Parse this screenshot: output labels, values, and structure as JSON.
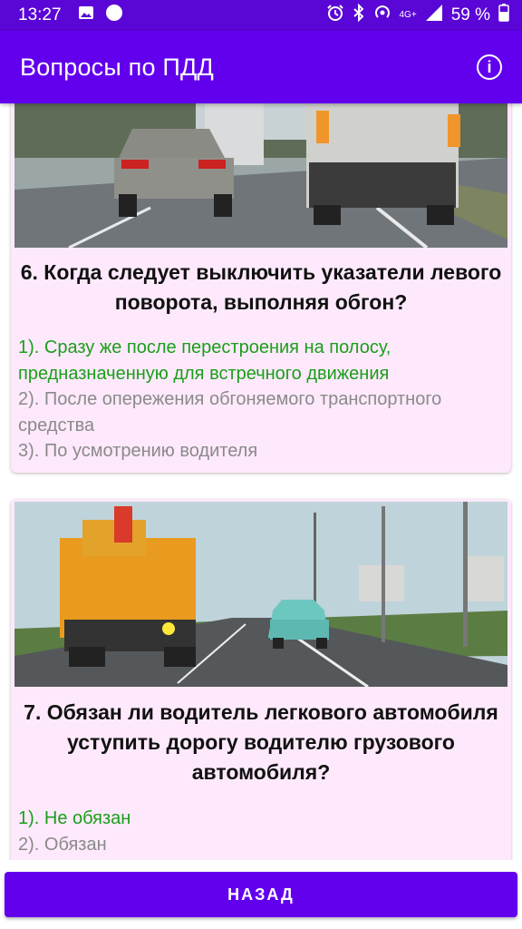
{
  "status_bar": {
    "time": "13:27",
    "network": "4G+",
    "battery": "59 %",
    "icons": [
      "image-icon",
      "circle-icon",
      "alarm-icon",
      "bluetooth-icon",
      "hotspot-icon",
      "signal-icon",
      "battery-icon"
    ]
  },
  "app_bar": {
    "title": "Вопросы по ПДД",
    "info_icon": "info-icon",
    "info_glyph": "i"
  },
  "questions": [
    {
      "title": "6. Когда следует выключить указатели левого поворота, выполняя обгон?",
      "answers": [
        {
          "text": "1). Сразу же после перестроения на полосу, предназначенную для встречного движения",
          "correct": true
        },
        {
          "text": "2). После опережения обгоняемого транспортного средства",
          "correct": false
        },
        {
          "text": "3). По усмотрению водителя",
          "correct": false
        }
      ]
    },
    {
      "title": "7. Обязан ли водитель легкового автомобиля уступить дорогу водителю грузового автомобиля?",
      "answers": [
        {
          "text": "1). Не обязан",
          "correct": true
        },
        {
          "text": "2). Обязан",
          "correct": false
        }
      ]
    }
  ],
  "bottom": {
    "back_label": "НАЗАД"
  },
  "colors": {
    "primary": "#6200ee",
    "status_bar": "#5a06d6",
    "card_bg": "#fde9fb",
    "correct": "#1a9e1a",
    "wrong": "#8a8a8a"
  }
}
